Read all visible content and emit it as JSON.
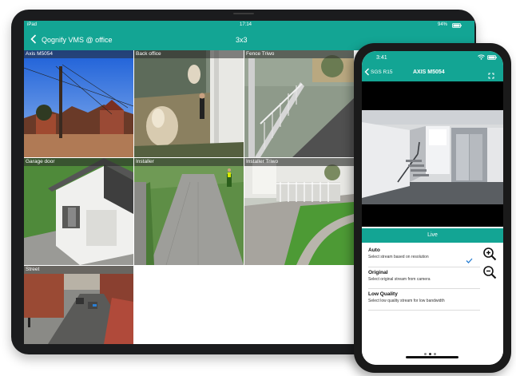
{
  "tablet": {
    "status": {
      "device": "iPad",
      "time": "17:14",
      "battery": "94%"
    },
    "nav": {
      "title": "Qognify VMS @ office",
      "layout": "3x3"
    },
    "cameras": [
      {
        "label": "Axis M5054"
      },
      {
        "label": "Back office"
      },
      {
        "label": "Fence Triwo"
      },
      {
        "label": "Garage door"
      },
      {
        "label": "Installer"
      },
      {
        "label": "Installer Triwo"
      },
      {
        "label": "Street"
      }
    ]
  },
  "phone": {
    "status": {
      "time": "3:41"
    },
    "nav": {
      "back_label": "SGS R15",
      "title": "AXIS M5054"
    },
    "sheet": {
      "title": "Live",
      "options": [
        {
          "title": "Auto",
          "desc": "Select stream based on resolution",
          "selected": true
        },
        {
          "title": "Original",
          "desc": "Select original stream from camera",
          "selected": false
        },
        {
          "title": "Low Quality",
          "desc": "Select low quality stream for low bandwidth",
          "selected": false
        }
      ]
    }
  },
  "colors": {
    "accent": "#13a594",
    "check": "#2a7fd4"
  },
  "icons": [
    "back-chevron-icon",
    "wifi-icon",
    "battery-icon",
    "expand-icon",
    "check-icon",
    "zoom-in-icon",
    "zoom-out-icon"
  ]
}
